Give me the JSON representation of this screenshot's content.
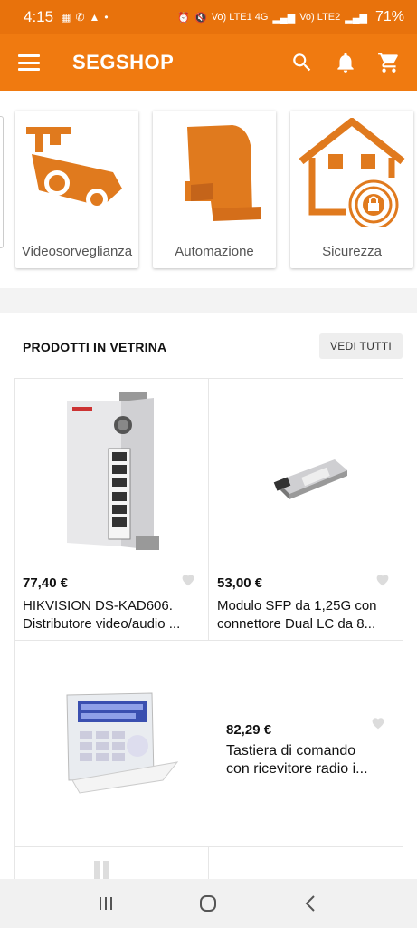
{
  "status_bar": {
    "time": "4:15",
    "left_icons": [
      "notification-icon",
      "phone-icon",
      "alert-icon",
      "dot"
    ],
    "signal_text": "Vo) LTE1 4G",
    "signal_text2": "Vo) LTE2",
    "battery": "71%"
  },
  "app_bar": {
    "title": "SEGSHOP",
    "accent_color": "#f07a10"
  },
  "categories": [
    {
      "label": "Videosorveglianza",
      "icon": "cctv-camera-icon"
    },
    {
      "label": "Automazione",
      "icon": "gate-automation-icon"
    },
    {
      "label": "Sicurezza",
      "icon": "house-lock-icon"
    }
  ],
  "featured": {
    "title": "PRODOTTI IN VETRINA",
    "see_all": "VEDI TUTTI"
  },
  "products": [
    {
      "price": "77,40 €",
      "name_line1": "HIKVISION DS-KAD606.",
      "name_line2": "Distributore video/audio ...",
      "image": "video-distributor-image"
    },
    {
      "price": "53,00 €",
      "name_line1": "Modulo SFP da 1,25G con",
      "name_line2": "connettore Dual LC da 8...",
      "image": "sfp-module-image"
    },
    {
      "price": "82,29 €",
      "name_line1": "Tastiera di comando",
      "name_line2": "con ricevitore radio i...",
      "image": "keypad-image"
    }
  ]
}
